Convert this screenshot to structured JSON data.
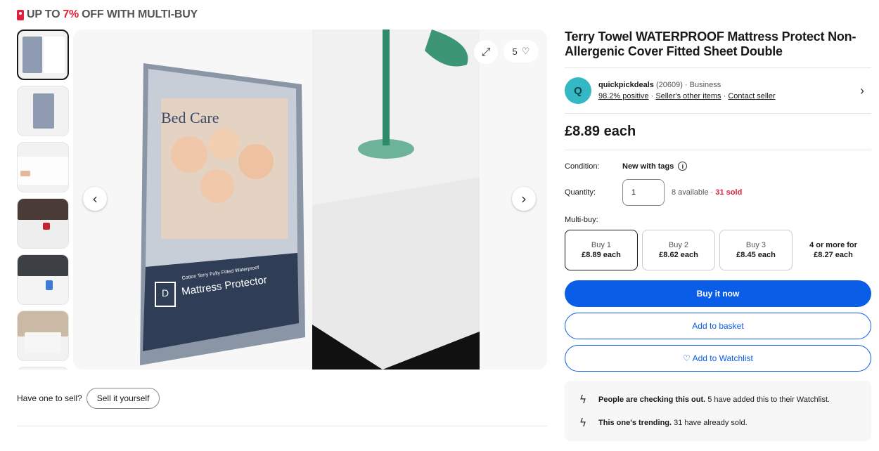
{
  "promo": {
    "prefix": "UP TO ",
    "percent": "7%",
    "suffix": " OFF WITH MULTI-BUY"
  },
  "gallery": {
    "watch_count": "5",
    "package_brand": "Bed Care",
    "package_line1": "Cotton Terry Fully Fitted Waterproof",
    "package_line2": "Mattress Protector",
    "size_letter": "D"
  },
  "sell": {
    "question": "Have one to sell?",
    "button": "Sell it yourself"
  },
  "product": {
    "title": "Terry Towel WATERPROOF Mattress Protect Non-Allergenic Cover Fitted Sheet Double",
    "price": "£8.89 each"
  },
  "seller": {
    "avatar_letter": "Q",
    "name": "quickpickdeals",
    "feedback_count": "(20609)",
    "type": "· Business",
    "positive": "98.2% positive",
    "other_items": "Seller's other items",
    "contact": "Contact seller"
  },
  "condition": {
    "label": "Condition:",
    "value": "New with tags"
  },
  "quantity": {
    "label": "Quantity:",
    "value": "1",
    "available": "8 available ·",
    "sold": "31 sold"
  },
  "multibuy": {
    "label": "Multi-buy:",
    "tiers": [
      {
        "label": "Buy 1",
        "price": "£8.89 each"
      },
      {
        "label": "Buy 2",
        "price": "£8.62 each"
      },
      {
        "label": "Buy 3",
        "price": "£8.45 each"
      },
      {
        "label": "4 or more for",
        "price": "£8.27 each"
      }
    ]
  },
  "actions": {
    "buy_now": "Buy it now",
    "add_basket": "Add to basket",
    "add_watchlist": "♡ Add to Watchlist"
  },
  "signals": [
    {
      "bold": "People are checking this out.",
      "text": "5 have added this to their Watchlist."
    },
    {
      "bold": "This one's trending.",
      "text": "31 have already sold."
    }
  ],
  "colors": {
    "accent": "#0a5de6",
    "sale": "#e0203c",
    "avatar": "#34b8c4"
  }
}
